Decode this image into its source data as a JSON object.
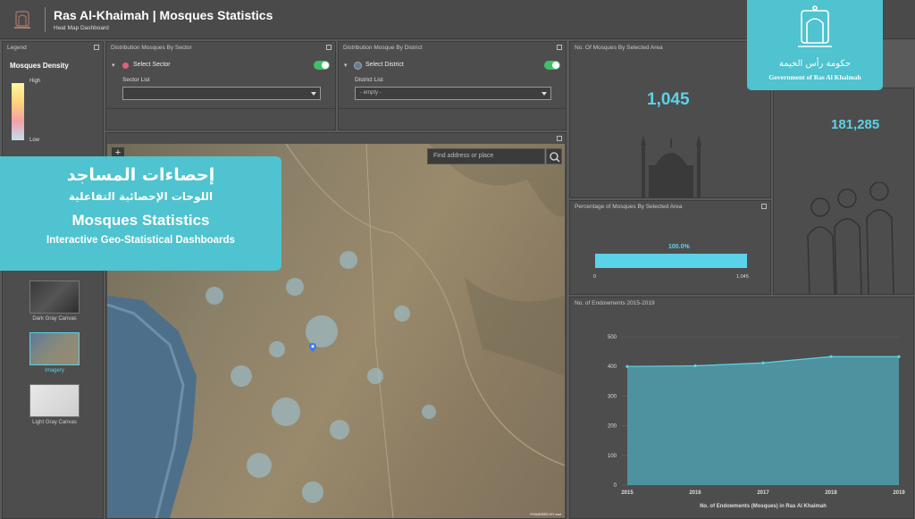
{
  "header": {
    "title": "Ras Al-Khaimah | Mosques Statistics",
    "subtitle": "Heat Map Dashboard"
  },
  "legend": {
    "panel_title": "Legend",
    "layer_title": "Mosques Density",
    "high": "High",
    "low": "Low"
  },
  "basemaps": [
    {
      "label": "Dark Gray Canvas",
      "selected": false
    },
    {
      "label": "Imagery",
      "selected": true
    },
    {
      "label": "Light Gray Canvas",
      "selected": false
    }
  ],
  "sector_panel": {
    "title": "Distribution Mosques By Sector",
    "toggle_label": "Select Sector",
    "list_label": "Sector List",
    "value": ""
  },
  "district_panel": {
    "title": "Distribution Mosque By District",
    "toggle_label": "Select District",
    "list_label": "District List",
    "value": "- empty -"
  },
  "map": {
    "search_placeholder": "Find address or place",
    "zoom_in": "+",
    "attribution": "POWERED BY esri"
  },
  "overlay": {
    "ar_title": "إحصاءات المساجد",
    "ar_subtitle": "اللوحات الإحصائية التفاعلية",
    "en_title": "Mosques Statistics",
    "en_subtitle": "Interactive Geo-Statistical Dashboards"
  },
  "count_panel": {
    "title": "No. Of Mosques By Selected Area",
    "value": "1,045"
  },
  "second_count": {
    "value": "181,285"
  },
  "gov_logo": {
    "ar": "حكومة رأس الخيمة",
    "en": "Government of Ras Al Khaimah"
  },
  "percentage_panel": {
    "title": "Percentage of Mosques By Selected Area",
    "value_label": "100.0%",
    "fraction": 1.0,
    "min_label": "0",
    "max_label": "1,045"
  },
  "endowments_panel": {
    "title": "No. of Endowments 2015-2019"
  },
  "colors": {
    "accent": "#5ad3e8",
    "panel": "#4d4d4d",
    "toggle": "#3fbf6a",
    "overlay": "#4fc3cf"
  },
  "chart_data": {
    "type": "area",
    "x": [
      2015,
      2016,
      2017,
      2018,
      2019
    ],
    "values": [
      400,
      402,
      412,
      433,
      433
    ],
    "xlabel": "No. of Endowments (Mosques) in Ras Al Khaimah",
    "ylabel": "",
    "ylim": [
      0,
      500
    ],
    "yticks": [
      0,
      100,
      200,
      300,
      400,
      500
    ],
    "grid": true
  }
}
